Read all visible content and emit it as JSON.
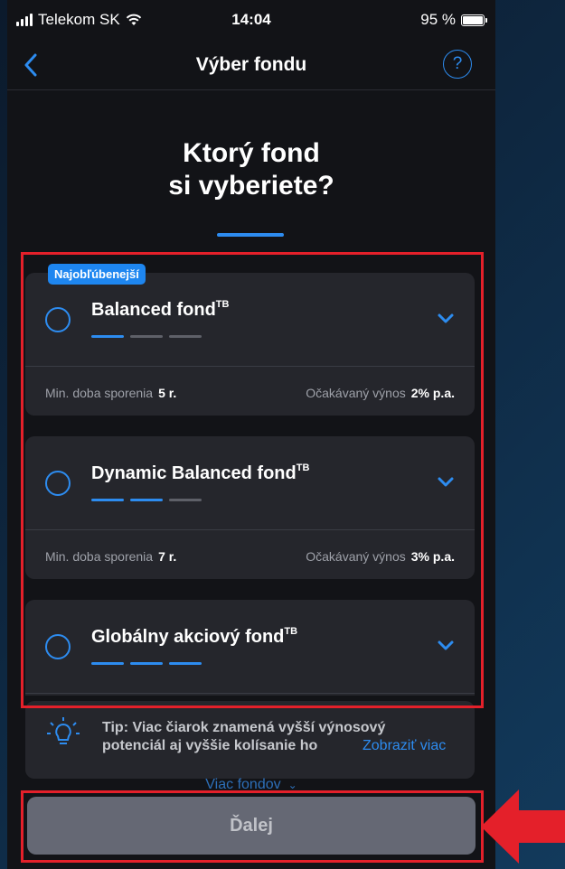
{
  "status_bar": {
    "carrier": "Telekom SK",
    "time": "14:04",
    "battery": "95 %"
  },
  "nav": {
    "title": "Výber fondu",
    "help_label": "?"
  },
  "headline": {
    "line1": "Ktorý fond",
    "line2": "si vyberiete?"
  },
  "badge": "Najobľúbenejší",
  "funds": [
    {
      "name": "Balanced fond",
      "sup": "TB",
      "risk_level": 1,
      "risk_max": 3,
      "min_label": "Min. doba sporenia",
      "min_value": "5 r.",
      "yield_label": "Očakávaný výnos",
      "yield_value": "2% p.a."
    },
    {
      "name": "Dynamic Balanced fond",
      "sup": "TB",
      "risk_level": 2,
      "risk_max": 3,
      "min_label": "Min. doba sporenia",
      "min_value": "7 r.",
      "yield_label": "Očakávaný výnos",
      "yield_value": "3% p.a."
    },
    {
      "name": "Globálny akciový fond",
      "sup": "TB",
      "risk_level": 3,
      "risk_max": 3
    }
  ],
  "tip": {
    "line1": "Tip: Viac čiarok znamená vyšší výnosový",
    "line2": "potenciál aj vyššie kolísanie ho",
    "link": "Zobraziť viac"
  },
  "more_funds": "Viac fondov",
  "next_button": "Ďalej",
  "colors": {
    "accent": "#2d8cf0",
    "highlight": "#e4202a",
    "card": "#25262c",
    "screen": "#121317"
  }
}
